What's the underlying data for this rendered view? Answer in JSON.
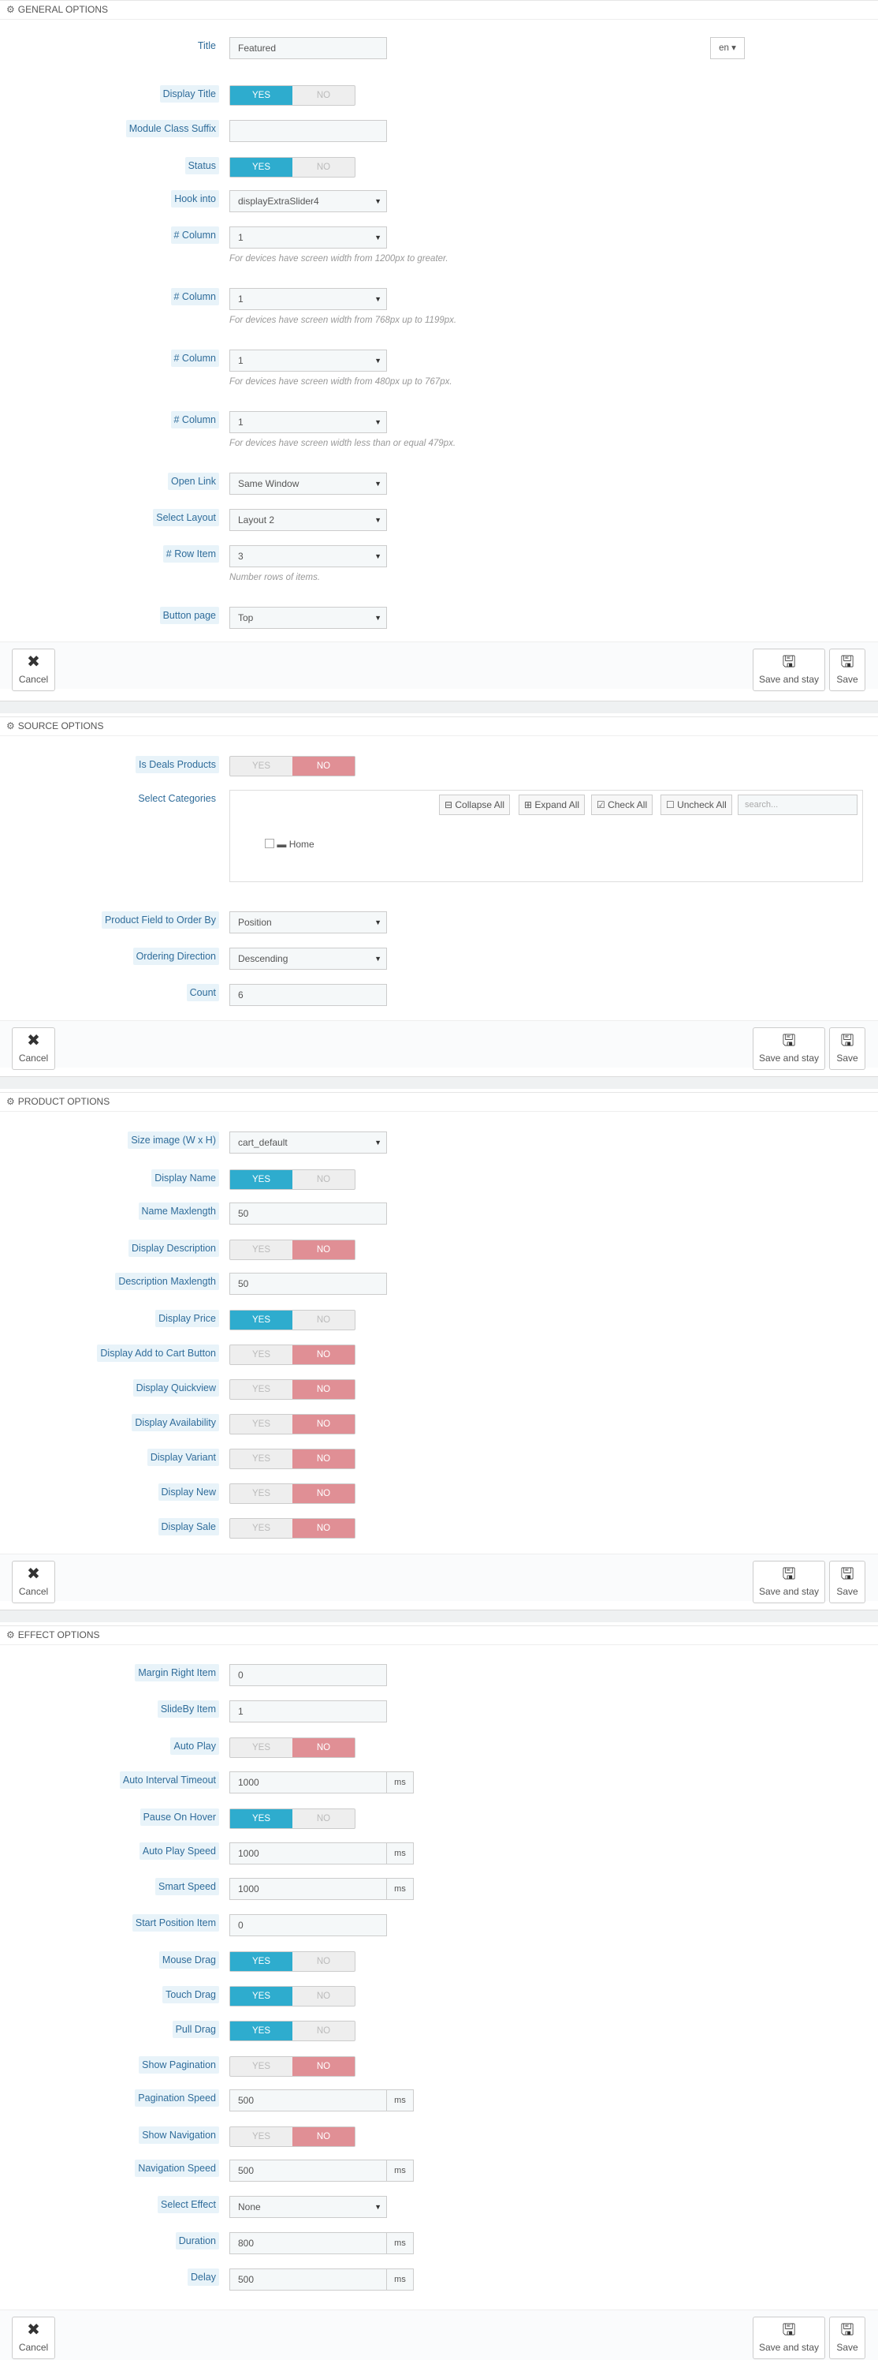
{
  "common": {
    "cancel": "Cancel",
    "save_stay": "Save and stay",
    "save": "Save",
    "yes": "YES",
    "no": "NO",
    "ms": "ms"
  },
  "general": {
    "heading": "GENERAL OPTIONS",
    "title_label": "Title",
    "title_value": "Featured",
    "lang": "en",
    "display_title": "Display Title",
    "suffix_label": "Module Class Suffix",
    "status": "Status",
    "hook_label": "Hook into",
    "hook_value": "displayExtraSlider4",
    "col_label": "# Column",
    "col_value": "1",
    "col_help1": "For devices have screen width from 1200px to greater.",
    "col_help2": "For devices have screen width from 768px up to 1199px.",
    "col_help3": "For devices have screen width from 480px up to 767px.",
    "col_help4": "For devices have screen width less than or equal 479px.",
    "open_label": "Open Link",
    "open_value": "Same Window",
    "layout_label": "Select Layout",
    "layout_value": "Layout 2",
    "row_label": "# Row Item",
    "row_value": "3",
    "row_help": "Number rows of items.",
    "btnpage_label": "Button page",
    "btnpage_value": "Top"
  },
  "source": {
    "heading": "SOURCE OPTIONS",
    "deals": "Is Deals Products",
    "cat_label": "Select Categories",
    "collapse": "Collapse All",
    "expand": "Expand All",
    "check": "Check All",
    "uncheck": "Uncheck All",
    "search_ph": "search...",
    "home": "Home",
    "order_label": "Product Field to Order By",
    "order_value": "Position",
    "dir_label": "Ordering Direction",
    "dir_value": "Descending",
    "count_label": "Count",
    "count_value": "6"
  },
  "product": {
    "heading": "PRODUCT OPTIONS",
    "size_label": "Size image (W x H)",
    "size_value": "cart_default",
    "name": "Display Name",
    "name_max_label": "Name Maxlength",
    "name_max_value": "50",
    "desc": "Display Description",
    "desc_max_label": "Description Maxlength",
    "desc_max_value": "50",
    "price": "Display Price",
    "cart": "Display Add to Cart Button",
    "quick": "Display Quickview",
    "avail": "Display Availability",
    "variant": "Display Variant",
    "new": "Display New",
    "sale": "Display Sale"
  },
  "effect": {
    "heading": "EFFECT OPTIONS",
    "margin_label": "Margin Right Item",
    "margin_value": "0",
    "slideby_label": "SlideBy Item",
    "slideby_value": "1",
    "autoplay": "Auto Play",
    "interval_label": "Auto Interval Timeout",
    "interval_value": "1000",
    "pause": "Pause On Hover",
    "apspeed_label": "Auto Play Speed",
    "apspeed_value": "1000",
    "smart_label": "Smart Speed",
    "smart_value": "1000",
    "start_label": "Start Position Item",
    "start_value": "0",
    "mouse": "Mouse Drag",
    "touch": "Touch Drag",
    "pull": "Pull Drag",
    "showpag": "Show Pagination",
    "pagspeed_label": "Pagination Speed",
    "pagspeed_value": "500",
    "shownav": "Show Navigation",
    "navspeed_label": "Navigation Speed",
    "navspeed_value": "500",
    "effect_label": "Select Effect",
    "effect_value": "None",
    "dur_label": "Duration",
    "dur_value": "800",
    "delay_label": "Delay",
    "delay_value": "500"
  }
}
